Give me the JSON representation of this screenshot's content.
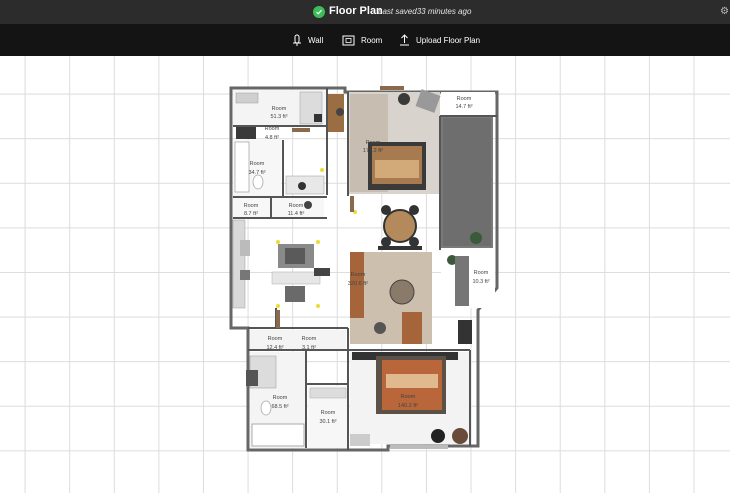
{
  "header": {
    "title": "Floor Plan",
    "saved_status": "Last saved33 minutes ago"
  },
  "toolbar": {
    "wall_label": "Wall",
    "room_label": "Room",
    "upload_label": "Upload Floor Plan"
  },
  "rooms": [
    {
      "name": "Room",
      "area": "51.3 ft²"
    },
    {
      "name": "Room",
      "area": "4.8 ft²"
    },
    {
      "name": "Room",
      "area": "34.7 ft²"
    },
    {
      "name": "Room",
      "area": "8.7 ft²"
    },
    {
      "name": "Room",
      "area": "11.4 ft²"
    },
    {
      "name": "Room",
      "area": "177.2 ft²"
    },
    {
      "name": "Room",
      "area": "14.7 ft²"
    },
    {
      "name": "Room",
      "area": "320.6 ft²"
    },
    {
      "name": "Room",
      "area": "10.3 ft²"
    },
    {
      "name": "Room",
      "area": "12.4 ft²"
    },
    {
      "name": "Room",
      "area": "3.1 ft²"
    },
    {
      "name": "Room",
      "area": "68.5 ft²"
    },
    {
      "name": "Room",
      "area": "30.1 ft²"
    },
    {
      "name": "Room",
      "area": "140.2 ft²"
    }
  ],
  "icons": {
    "status": "check-circle-icon",
    "wall": "wall-icon",
    "room": "room-icon",
    "upload": "upload-icon",
    "settings": "gear-icon"
  },
  "colors": {
    "topbar": "#2c2c2c",
    "toolbar": "#141414",
    "status_green": "#3dbd5a",
    "wall": "#555555",
    "floor_wood": "#a97a4d",
    "rug": "#cdbfae"
  }
}
